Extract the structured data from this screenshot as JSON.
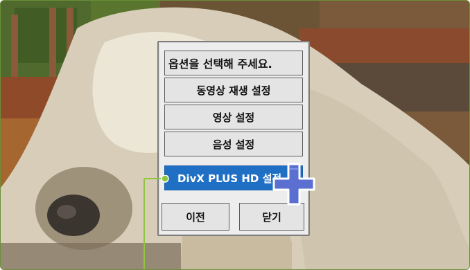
{
  "menu": {
    "header": "옵션을 선택해 주세요.",
    "items": [
      {
        "label": "동영상 재생 설정"
      },
      {
        "label": "영상 설정"
      },
      {
        "label": "음성 설정"
      },
      {
        "label": "DivX PLUS HD 설정",
        "selected": true
      }
    ],
    "prev_label": "이전",
    "close_label": "닫기"
  },
  "colors": {
    "selected_item": "#1f6fc4",
    "cursor": "#5a6fd0",
    "callout": "#8ec63f",
    "frame_border": "#6a8f37"
  },
  "icons": {
    "cursor": "plus-cursor-icon",
    "callout": "callout-pointer-icon"
  }
}
